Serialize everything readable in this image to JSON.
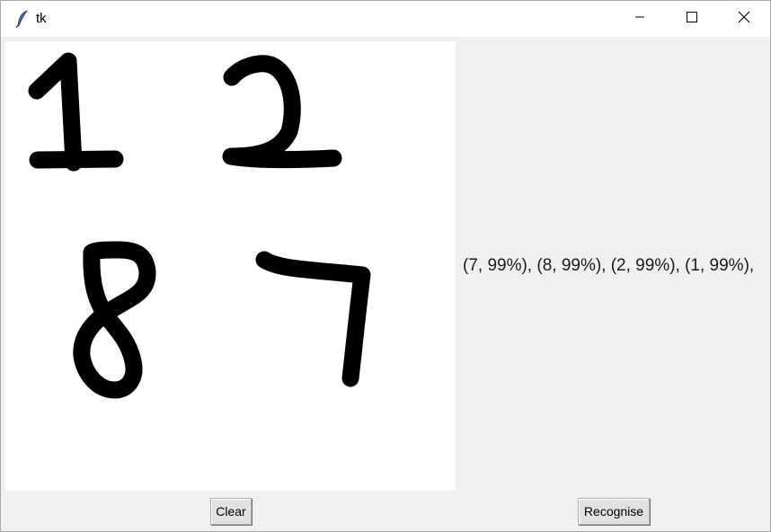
{
  "window": {
    "title": "tk",
    "app_icon": "feather-icon",
    "controls": [
      "minimize-icon",
      "maximize-icon",
      "close-icon"
    ]
  },
  "canvas": {
    "drawn_digits": [
      "1",
      "2",
      "8",
      "7"
    ],
    "ink_color": "#000000",
    "background_color": "#ffffff"
  },
  "result": {
    "text": "(7, 99%), (8, 99%), (2, 99%), (1, 99%),"
  },
  "buttons": {
    "clear_label": "Clear",
    "recognise_label": "Recognise"
  }
}
